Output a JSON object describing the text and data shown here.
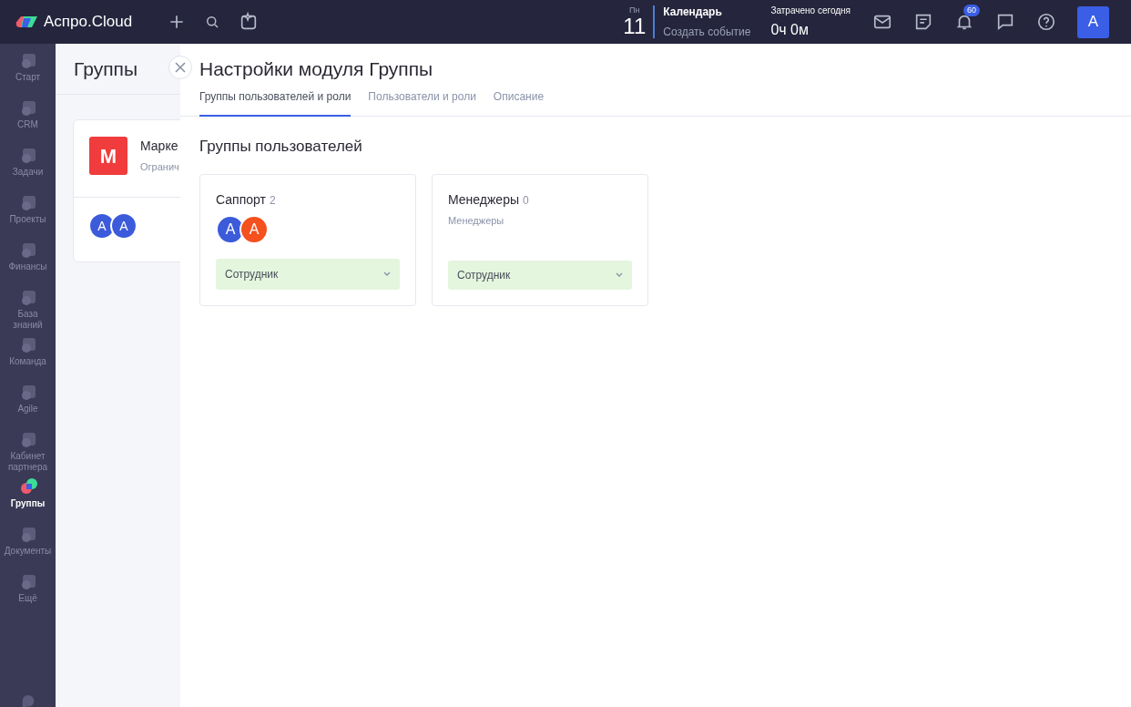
{
  "topbar": {
    "logo": "Аспро.Cloud",
    "day_name": "Пн",
    "day_number": "11",
    "calendar_title": "Календарь",
    "calendar_action": "Создать событие",
    "time_label": "Затрачено сегодня",
    "time_value": "0ч 0м",
    "notifications_count": "60",
    "user_initial": "A"
  },
  "sidebar": {
    "items": [
      {
        "label": "Старт",
        "selected": false
      },
      {
        "label": "CRM",
        "selected": false
      },
      {
        "label": "Задачи",
        "selected": false
      },
      {
        "label": "Проекты",
        "selected": false
      },
      {
        "label": "Финансы",
        "selected": false
      },
      {
        "label": "База знаний",
        "selected": false
      },
      {
        "label": "Команда",
        "selected": false
      },
      {
        "label": "Agile",
        "selected": false
      },
      {
        "label": "Кабинет партнера",
        "selected": false
      },
      {
        "label": "Группы",
        "selected": true
      },
      {
        "label": "Документы",
        "selected": false
      },
      {
        "label": "Ещё",
        "selected": false
      }
    ]
  },
  "background_page": {
    "title": "Группы",
    "card": {
      "logo_letter": "M",
      "name": "Марке",
      "subtitle": "Огранич",
      "members": [
        {
          "initial": "A",
          "color": "#3b5bdb"
        },
        {
          "initial": "A",
          "color": "#3b5bdb"
        }
      ]
    }
  },
  "panel": {
    "title": "Настройки модуля Группы",
    "tabs": [
      {
        "label": "Группы пользователей и роли",
        "selected": true
      },
      {
        "label": "Пользователи и роли",
        "selected": false
      },
      {
        "label": "Описание",
        "selected": false
      }
    ],
    "section_title": "Группы пользователей",
    "groups": [
      {
        "name": "Саппорт",
        "count": "2",
        "members": [
          {
            "initial": "A",
            "color": "#3b5bdb"
          },
          {
            "initial": "A",
            "color": "#f4511e"
          }
        ],
        "role": "Сотрудник"
      },
      {
        "name": "Менеджеры",
        "count": "0",
        "description": "Менеджеры",
        "role": "Сотрудник"
      }
    ]
  }
}
